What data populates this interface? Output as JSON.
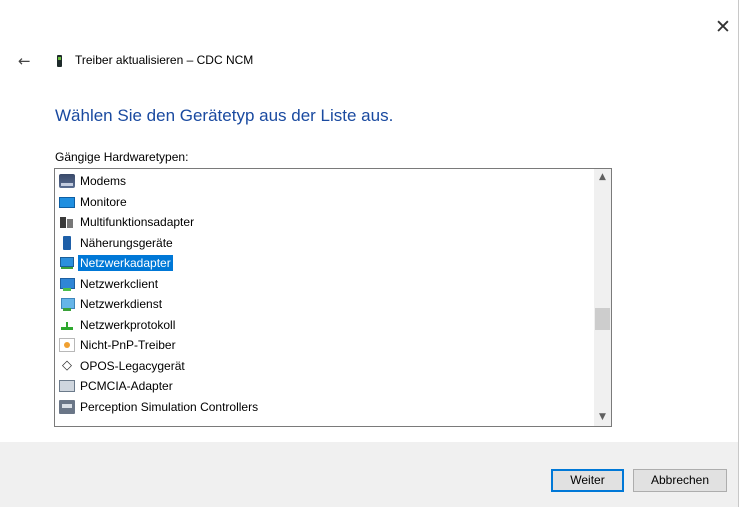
{
  "window": {
    "close_glyph": "✕",
    "back_glyph": "←",
    "title": "Treiber aktualisieren – CDC NCM"
  },
  "main": {
    "heading": "Wählen Sie den Gerätetyp aus der Liste aus.",
    "list_label": "Gängige Hardwaretypen:"
  },
  "hardware_list": {
    "selected_index": 4,
    "items": [
      {
        "label": "Modems",
        "icon": "modem-icon"
      },
      {
        "label": "Monitore",
        "icon": "monitor-icon"
      },
      {
        "label": "Multifunktionsadapter",
        "icon": "multifunction-adapter-icon"
      },
      {
        "label": "Näherungsgeräte",
        "icon": "proximity-device-icon"
      },
      {
        "label": "Netzwerkadapter",
        "icon": "network-adapter-icon"
      },
      {
        "label": "Netzwerkclient",
        "icon": "network-client-icon"
      },
      {
        "label": "Netzwerkdienst",
        "icon": "network-service-icon"
      },
      {
        "label": "Netzwerkprotokoll",
        "icon": "network-protocol-icon"
      },
      {
        "label": "Nicht-PnP-Treiber",
        "icon": "non-pnp-driver-icon"
      },
      {
        "label": "OPOS-Legacygerät",
        "icon": "opos-device-icon"
      },
      {
        "label": "PCMCIA-Adapter",
        "icon": "pcmcia-adapter-icon"
      },
      {
        "label": "Perception Simulation Controllers",
        "icon": "perception-controller-icon"
      }
    ],
    "scroll_up_glyph": "▲",
    "scroll_down_glyph": "▼"
  },
  "footer": {
    "next_label": "Weiter",
    "cancel_label": "Abbrechen"
  }
}
